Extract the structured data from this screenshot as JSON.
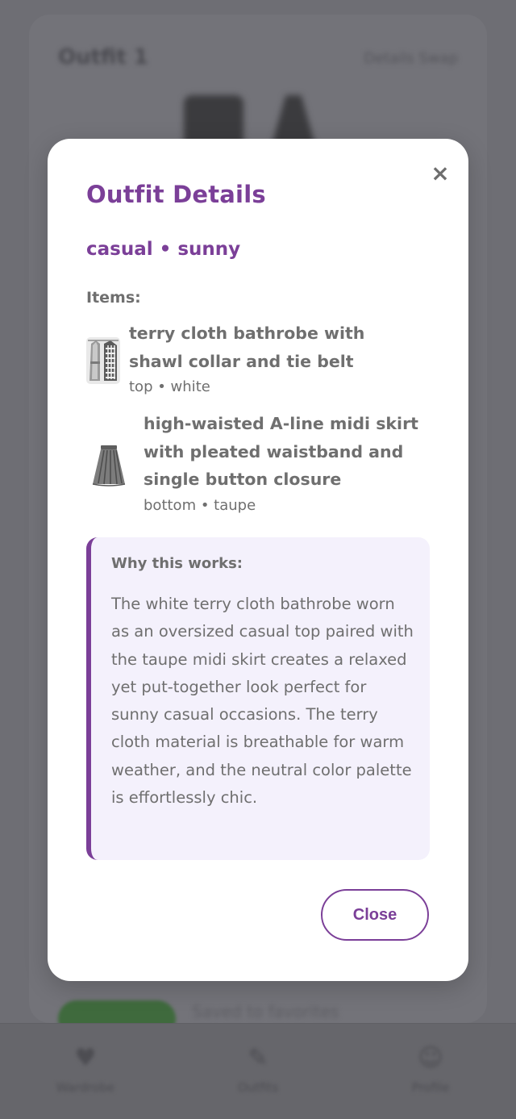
{
  "background": {
    "title": "Outfit 1",
    "link": "Details  Swap",
    "pill_text": "Saved to favorites",
    "nav": [
      {
        "icon": "heart-icon",
        "label": "Wardrobe"
      },
      {
        "icon": "pencil-icon",
        "label": "Outfits"
      },
      {
        "icon": "user-icon",
        "label": "Profile"
      }
    ]
  },
  "modal": {
    "close_icon": "×",
    "title": "Outfit Details",
    "tags": "casual • sunny",
    "items_label": "Items:",
    "items": [
      {
        "name": "terry cloth bathrobe with shawl collar and tie belt",
        "meta": "top • white",
        "icon": "bathrobe-thumbnail"
      },
      {
        "name": "high-waisted A-line midi skirt with pleated waistband and single button closure",
        "meta": "bottom • taupe",
        "icon": "skirt-thumbnail"
      }
    ],
    "why_title": "Why this works:",
    "why_text": "The white terry cloth bathrobe worn as an oversized casual top paired with the taupe midi skirt creates a relaxed yet put-together look perfect for sunny casual occasions. The terry cloth material is breathable for warm weather, and the neutral color palette is effortlessly chic.",
    "close_label": "Close"
  },
  "colors": {
    "accent": "#7b3f98",
    "text": "#6f6f6f",
    "panel": "#f4f1fc",
    "overlay": "#6e6e74"
  }
}
